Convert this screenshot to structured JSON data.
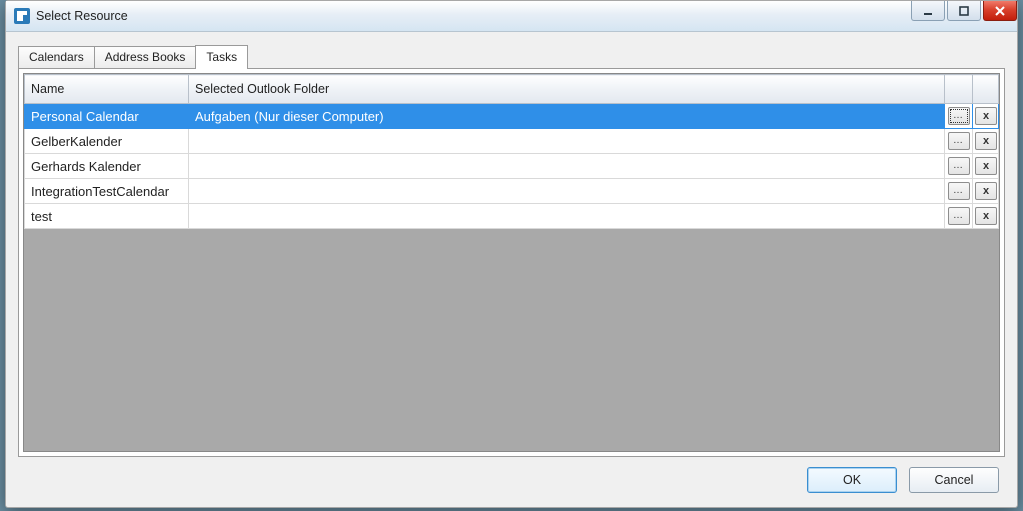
{
  "window": {
    "title": "Select Resource"
  },
  "tabs": {
    "calendars": "Calendars",
    "address_books": "Address Books",
    "tasks": "Tasks",
    "active": "tasks"
  },
  "columns": {
    "name": "Name",
    "folder": "Selected Outlook Folder"
  },
  "rows": [
    {
      "name": "Personal Calendar",
      "folder": "Aufgaben (Nur dieser Computer)",
      "selected": true
    },
    {
      "name": "GelberKalender",
      "folder": "",
      "selected": false
    },
    {
      "name": "Gerhards Kalender",
      "folder": "",
      "selected": false
    },
    {
      "name": "IntegrationTestCalendar",
      "folder": "",
      "selected": false
    },
    {
      "name": "test",
      "folder": "",
      "selected": false
    }
  ],
  "buttons": {
    "ok": "OK",
    "cancel": "Cancel",
    "browse_glyph": "…",
    "delete_glyph": "x"
  }
}
